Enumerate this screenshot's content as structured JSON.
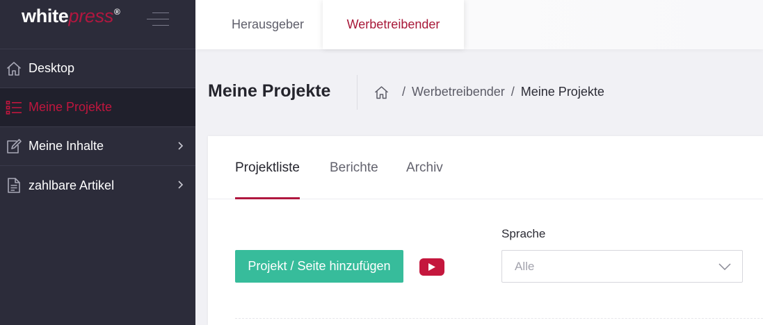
{
  "brand": {
    "logo_bold": "white",
    "logo_italic": "press",
    "logo_mark": "®",
    "menu_icon": "hamburger-icon"
  },
  "sidebar": {
    "items": [
      {
        "label": "Desktop",
        "icon": "home-icon",
        "active": false,
        "has_submenu": false
      },
      {
        "label": "Meine Projekte",
        "icon": "list-icon",
        "active": true,
        "has_submenu": false
      },
      {
        "label": "Meine Inhalte",
        "icon": "edit-icon",
        "active": false,
        "has_submenu": true
      },
      {
        "label": "zahlbare Artikel",
        "icon": "document-icon",
        "active": false,
        "has_submenu": true
      }
    ]
  },
  "topbar": {
    "tabs": [
      {
        "label": "Herausgeber",
        "active": false
      },
      {
        "label": "Werbetreibender",
        "active": true
      }
    ]
  },
  "header": {
    "title": "Meine Projekte",
    "breadcrumb": {
      "home_icon": "home-icon",
      "separator": "/",
      "items": [
        "Werbetreibender",
        "Meine Projekte"
      ]
    }
  },
  "content": {
    "tabs": [
      {
        "label": "Projektliste",
        "active": true
      },
      {
        "label": "Berichte",
        "active": false
      },
      {
        "label": "Archiv",
        "active": false
      }
    ],
    "add_button_label": "Projekt / Seite hinzufügen",
    "video_icon": "youtube-icon",
    "language": {
      "label": "Sprache",
      "selected": "Alle"
    }
  },
  "colors": {
    "sidebar_bg": "#2c2c3a",
    "accent": "#b0173f",
    "primary_button": "#37bc9b",
    "youtube": "#c4173d"
  }
}
